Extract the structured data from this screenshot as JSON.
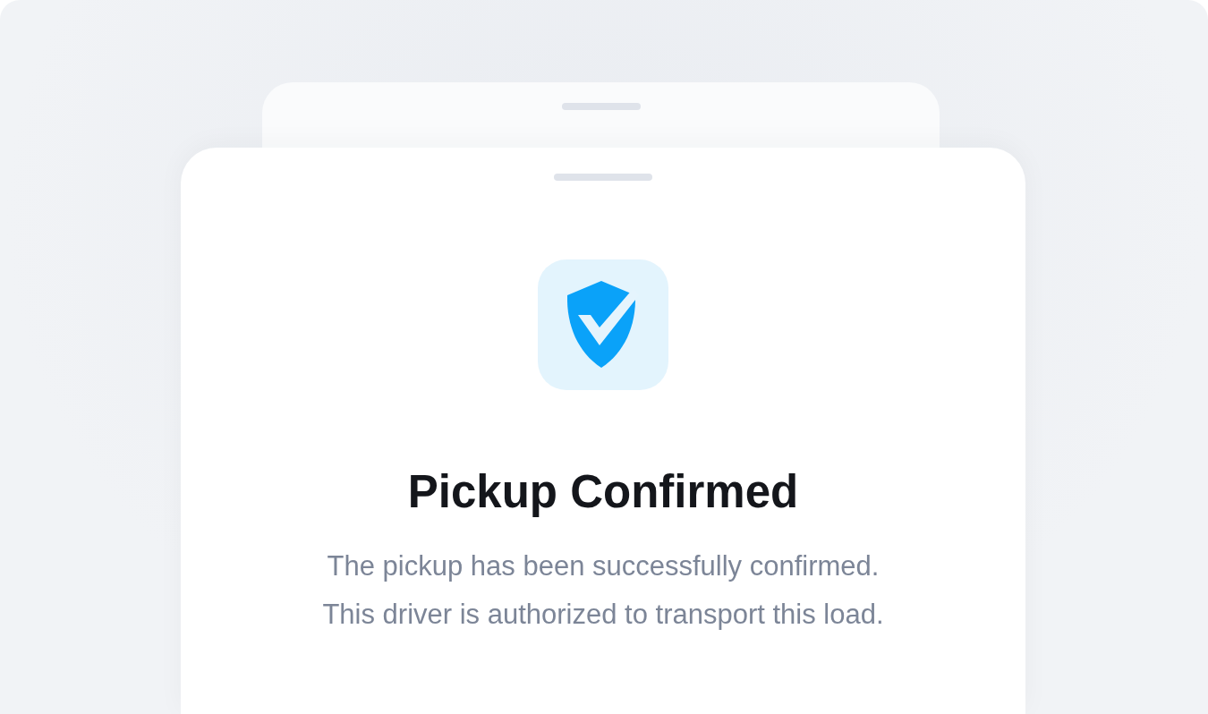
{
  "title": "Pickup Confirmed",
  "message": "The pickup has been successfully confirmed.\nThis driver is authorized to transport this load."
}
